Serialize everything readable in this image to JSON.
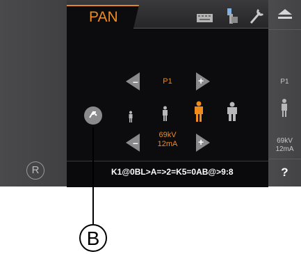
{
  "tab": {
    "label": "PAN"
  },
  "program": {
    "label": "P1"
  },
  "exposure": {
    "kv": "69kV",
    "ma": "12mA"
  },
  "side": {
    "program": "P1",
    "kv": "69kV",
    "ma": "12mA",
    "help": "?"
  },
  "status": {
    "text": "K1@0BL>A=>2=K5=0AB@>9:8"
  },
  "callout": {
    "label": "B"
  },
  "left": {
    "r_label": "R"
  },
  "icons": {
    "keyboard": "keyboard-icon",
    "device": "device-icon",
    "tools": "wrench-icon",
    "eject": "eject-icon",
    "arrow_left": "arrow-left-icon",
    "arrow_right_plus": "plus-arrow-icon",
    "rotate": "rotate-icon",
    "patient_child": "patient-child-icon",
    "patient_small": "patient-small-icon",
    "patient_medium": "patient-medium-icon",
    "patient_large": "patient-large-icon"
  },
  "colors": {
    "accent": "#f08c1e",
    "screen_bg": "#0c0c0e",
    "panel": "#4a4a4c"
  }
}
